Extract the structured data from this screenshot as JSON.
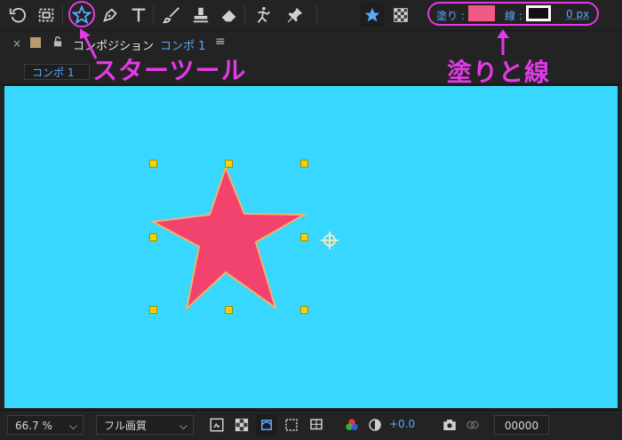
{
  "toolbar": {
    "fill_label": "塗り :",
    "stroke_label": "線 :",
    "stroke_width": "0 px"
  },
  "panel": {
    "title": "コンポジション",
    "comp_name": "コンポ 1",
    "tab_label": "コンポ 1"
  },
  "annotations": {
    "star_tool": "スターツール",
    "fill_stroke": "塗りと線"
  },
  "bottom": {
    "zoom": "66.7 %",
    "quality": "フル画質",
    "exposure": "+0.0",
    "timecode": "00000"
  },
  "colors": {
    "canvas": "#37d7ff",
    "star_fill": "#f2436f",
    "star_stroke": "#f0b36a",
    "annotation": "#e23ae8",
    "accent": "#5aa9ff"
  },
  "icons": [
    "rotate-icon",
    "camera-track-icon",
    "star-tool-icon",
    "pen-tool-icon",
    "type-tool-icon",
    "brush-icon",
    "clone-stamp-icon",
    "eraser-icon",
    "puppet-icon",
    "pin-icon",
    "star-shape-icon",
    "checker-icon",
    "close-icon",
    "color-swatch-icon",
    "lock-icon",
    "menu-icon",
    "chevron-down-icon",
    "snapshot-icon",
    "channel-icon",
    "exposure-icon",
    "camera-icon",
    "link-icon"
  ]
}
